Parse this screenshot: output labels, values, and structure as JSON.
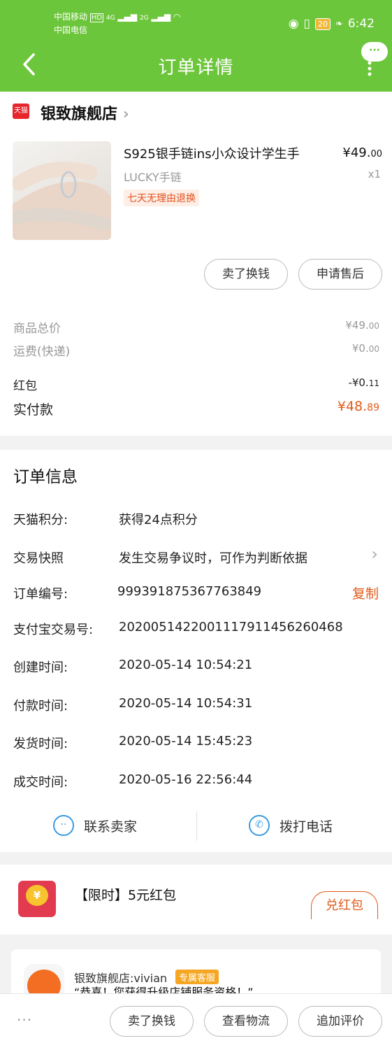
{
  "status": {
    "carrier1": "中国移动",
    "carrier2": "中国电信",
    "hd": "HD",
    "net1": "4G",
    "net2": "2G",
    "battery": "20",
    "time": "6:42"
  },
  "header": {
    "title": "订单详情",
    "bubble": "···"
  },
  "shop": {
    "logo_text": "天猫",
    "name": "银致旗舰店"
  },
  "product": {
    "title": "S925银手链ins小众设计学生手",
    "spec": "LUCKY手链",
    "tag": "七天无理由退换",
    "price_int": "¥49.",
    "price_dec": "00",
    "qty": "x1"
  },
  "item_actions": {
    "sell": "卖了换钱",
    "after_sale": "申请售后"
  },
  "summary": {
    "goods_total_label": "商品总价",
    "goods_total_int": "¥49.",
    "goods_total_dec": "00",
    "shipping_label": "运费(快递)",
    "shipping_int": "¥0.",
    "shipping_dec": "00",
    "redpacket_label": "红包",
    "redpacket_int": "-¥0.",
    "redpacket_dec": "11",
    "paid_label": "实付款",
    "paid_int": "¥48.",
    "paid_dec": "89"
  },
  "order_info": {
    "heading": "订单信息",
    "rows": [
      {
        "label": "天猫积分:",
        "value": "获得24点积分"
      },
      {
        "label": "交易快照",
        "value": "发生交易争议时，可作为判断依据"
      },
      {
        "label": "订单编号:",
        "value": "999391875367763849"
      },
      {
        "label": "支付宝交易号:",
        "value": "2020051422001117911456260468"
      },
      {
        "label": "创建时间:",
        "value": "2020-05-14 10:54:21"
      },
      {
        "label": "付款时间:",
        "value": "2020-05-14 10:54:31"
      },
      {
        "label": "发货时间:",
        "value": "2020-05-14 15:45:23"
      },
      {
        "label": "成交时间:",
        "value": "2020-05-16 22:56:44"
      }
    ],
    "copy": "复制"
  },
  "contact": {
    "seller": "联系卖家",
    "phone": "拨打电话"
  },
  "promo": {
    "text": "【限时】5元红包",
    "button": "兑红包",
    "icon_char": "¥"
  },
  "service": {
    "name": "银致旗舰店:vivian",
    "badge": "专属客服",
    "message": "“恭喜！您获得升级店铺服务资格！”"
  },
  "bottom": {
    "more": "···",
    "sell": "卖了换钱",
    "logistics": "查看物流",
    "review": "追加评价"
  },
  "colors": {
    "brand_green": "#6cc63b",
    "accent_orange": "#e25a1a",
    "tmall_red": "#e7252c",
    "contact_blue": "#3a9be0"
  }
}
